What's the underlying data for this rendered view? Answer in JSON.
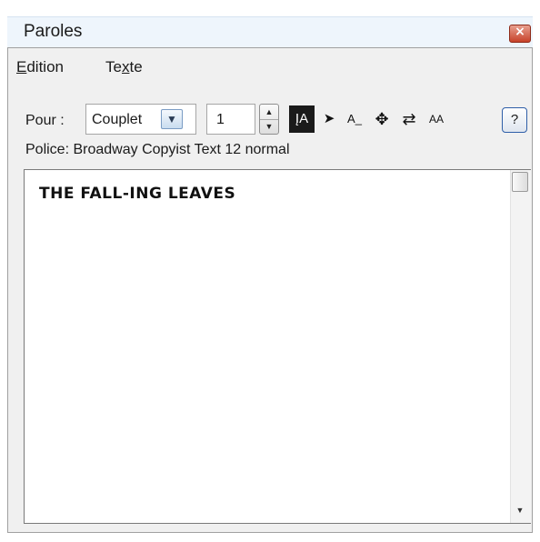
{
  "window": {
    "title": "Paroles",
    "close_icon": "close-icon",
    "close_glyph": "×"
  },
  "menu": {
    "items": [
      {
        "accel": "E",
        "rest": "dition"
      },
      {
        "pre": "Te",
        "accel": "x",
        "rest": "te"
      }
    ]
  },
  "toolbar": {
    "pour_label": "Pour :",
    "selected_option": "Couplet",
    "dropdown_glyph": "▼",
    "number_value": "1",
    "spin_up_glyph": "▲",
    "spin_down_glyph": "▼",
    "tools": [
      {
        "icon": "text-insert-tool-icon",
        "glyph": "ĮA"
      },
      {
        "icon": "select-arrow-tool-icon",
        "glyph": "➤"
      },
      {
        "icon": "baseline-tool-icon",
        "glyph": "A_"
      },
      {
        "icon": "move-tool-icon",
        "glyph": "✥"
      },
      {
        "icon": "swap-tool-icon",
        "glyph": "⇄"
      },
      {
        "icon": "font-size-tool-icon",
        "glyph": "AA"
      }
    ],
    "help_label": "?"
  },
  "police_text": "Police: Broadway Copyist Text 12 normal",
  "lyrics": {
    "text": "THE FALL-ING LEAVES",
    "scroll_down_glyph": "▼"
  },
  "colors": {
    "title_bg": "#eef5fc",
    "frame_bg": "#f0f0f0",
    "close_red": "#c7432a",
    "active_tool_bg": "#1a1a1a"
  }
}
